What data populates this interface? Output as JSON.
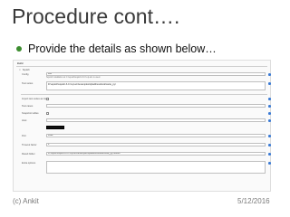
{
  "slide": {
    "title": "Procedure cont….",
    "bullet": "Provide the details as shown below…",
    "footer_left": "(c) Ankit",
    "footer_right": "5/12/2016"
  },
  "screenshot": {
    "build_header": "Build",
    "section_title": "Squish",
    "rows": [
      {
        "label": "Config",
        "value": "x86"
      },
      {
        "label": "Test suites",
        "value": "D:\\squish\\squish-6.0.3-qt-win\\examples\\qt\\addressbook\\suite_py\\"
      },
      {
        "label": "Import test suites as zip",
        "value": ""
      },
      {
        "label": "Test cases",
        "value": ""
      },
      {
        "label": "Snapshot tables",
        "value": ""
      },
      {
        "label": "Host",
        "value": ""
      },
      {
        "label": "Port",
        "value": "4322"
      },
      {
        "label": "Timeout factor",
        "value": "1"
      },
      {
        "label": "Result folder",
        "value": "D:\\squish\\squish-6.0.3-qt-win\\examples\\qt\\addressbook\\suite_py\\results"
      },
      {
        "label": "Extra options",
        "value": ""
      }
    ],
    "config_note": "Squish installation at C:\\squish\\squish-6.0.3-qt-win is used."
  }
}
